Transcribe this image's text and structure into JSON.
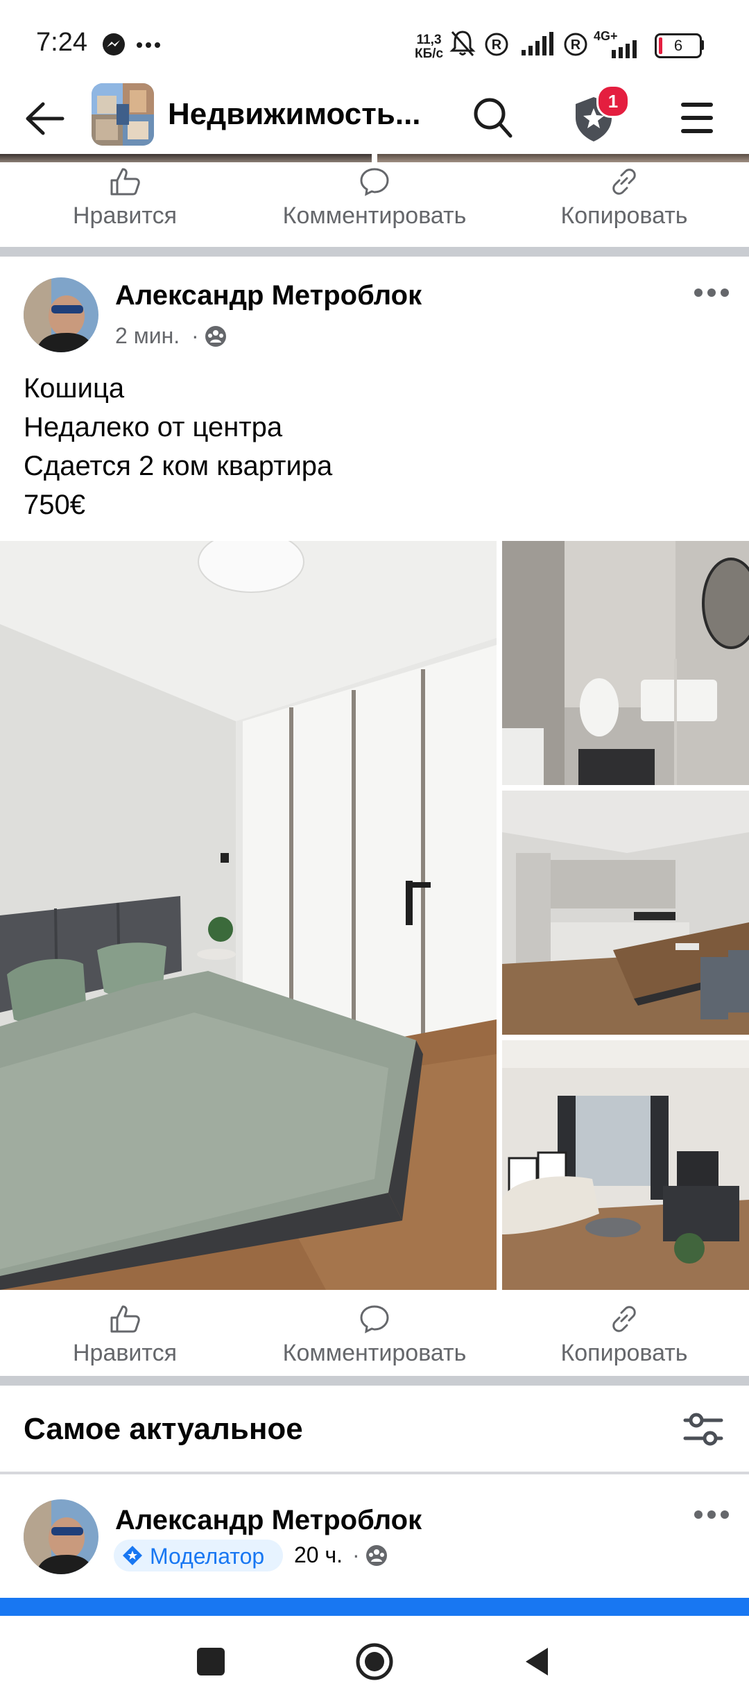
{
  "status_bar": {
    "time": "7:24",
    "network_speed_value": "11,3",
    "network_speed_unit": "КБ/с",
    "network_type": "4G+",
    "battery": "6"
  },
  "app_bar": {
    "group_title": "Недвижимость...",
    "notification_count": "1"
  },
  "post_actions": {
    "like": "Нравится",
    "comment": "Комментировать",
    "copy": "Копировать"
  },
  "post": {
    "author": "Александр Метроблок",
    "time": "2 мин.",
    "separator": "·",
    "text_lines": [
      "Кошица",
      "Недалеко от центра",
      "Сдается 2 ком квартира",
      "750€"
    ]
  },
  "section": {
    "title": "Самое актуальное"
  },
  "next_post": {
    "author": "Александр Метроблок",
    "badge": "Моделатор",
    "time": "20 ч.",
    "separator": "·"
  },
  "colors": {
    "accent": "#1877f2",
    "notification": "#e41e3f",
    "secondary_text": "#65676b",
    "divider": "#c9ccd1"
  },
  "icons": [
    "messenger-icon",
    "more-horizontal-icon",
    "mute-bell-icon",
    "registered-icon",
    "signal-icon",
    "battery-icon",
    "back-arrow-icon",
    "search-icon",
    "shield-star-icon",
    "menu-icon",
    "like-icon",
    "comment-icon",
    "link-icon",
    "globe-group-icon",
    "filter-icon",
    "moderator-icon",
    "nav-square-icon",
    "nav-home-icon",
    "nav-back-icon"
  ]
}
